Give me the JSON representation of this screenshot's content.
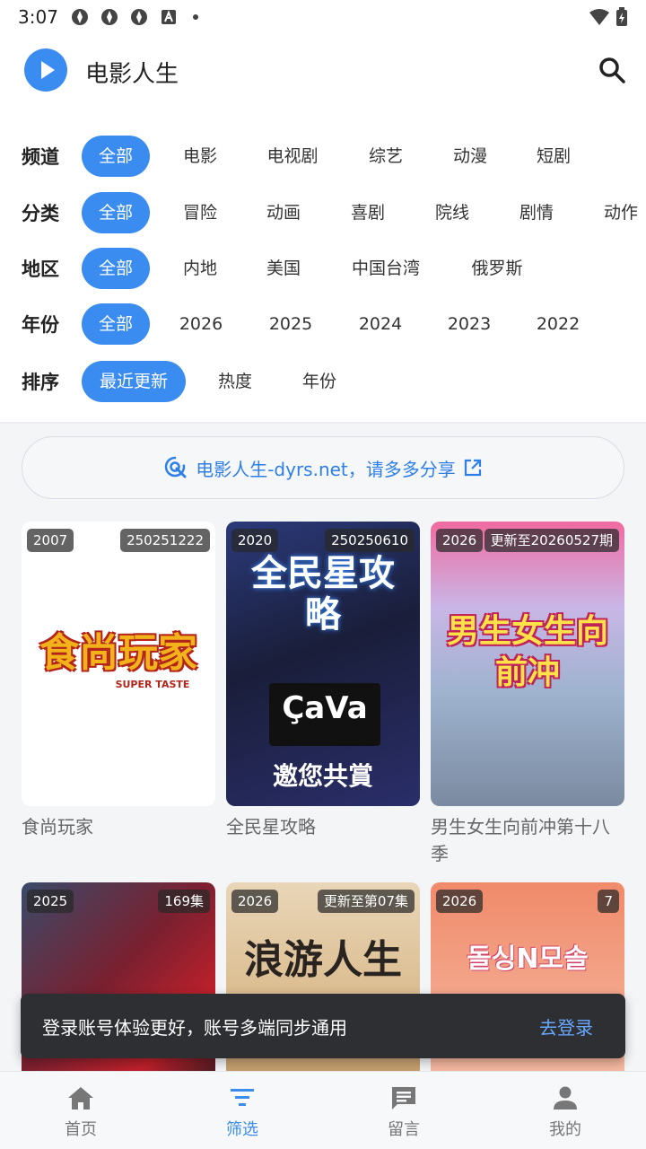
{
  "status_bar": {
    "time": "3:07"
  },
  "header": {
    "title": "电影人生"
  },
  "filters": {
    "channel": {
      "label": "频道",
      "options": [
        "全部",
        "电影",
        "电视剧",
        "综艺",
        "动漫",
        "短剧"
      ]
    },
    "category": {
      "label": "分类",
      "options": [
        "全部",
        "冒险",
        "动画",
        "喜剧",
        "院线",
        "剧情",
        "动作"
      ]
    },
    "region": {
      "label": "地区",
      "options": [
        "全部",
        "内地",
        "美国",
        "中国台湾",
        "俄罗斯"
      ]
    },
    "year": {
      "label": "年份",
      "options": [
        "全部",
        "2026",
        "2025",
        "2024",
        "2023",
        "2022"
      ]
    },
    "sort": {
      "label": "排序",
      "options": [
        "最近更新",
        "热度",
        "年份"
      ]
    }
  },
  "share_banner": {
    "text": "电影人生-dyrs.net，请多多分享"
  },
  "items": [
    {
      "year": "2007",
      "status": "250251222",
      "title": "食尚玩家",
      "poster_text": "食尚玩家",
      "poster_sub": "SUPER TASTE"
    },
    {
      "year": "2020",
      "status": "250250610",
      "title": "全民星攻略",
      "poster_text": "全民星攻略",
      "poster_sub": "ÇaVa",
      "poster_sub2": "邀您共賞"
    },
    {
      "year": "2026",
      "status": "更新至20260527期",
      "title": "男生女生向前冲第十八季",
      "poster_text": "男生女生向前冲"
    },
    {
      "year": "2025",
      "status": "169集",
      "title": ""
    },
    {
      "year": "2026",
      "status": "更新至第07集",
      "title": "",
      "poster_text": "浪游人生"
    },
    {
      "year": "2026",
      "status": "7",
      "title": "",
      "poster_text": "돌싱N모솔"
    }
  ],
  "toast": {
    "message": "登录账号体验更好，账号多端同步通用",
    "action": "去登录"
  },
  "bottom_nav": [
    {
      "label": "首页",
      "icon": "home-icon"
    },
    {
      "label": "筛选",
      "icon": "filter-icon"
    },
    {
      "label": "留言",
      "icon": "message-icon"
    },
    {
      "label": "我的",
      "icon": "user-icon"
    }
  ],
  "colors": {
    "accent": "#3b8cf0",
    "toast_bg": "#2d2f33",
    "toast_action": "#6aa8ff"
  }
}
